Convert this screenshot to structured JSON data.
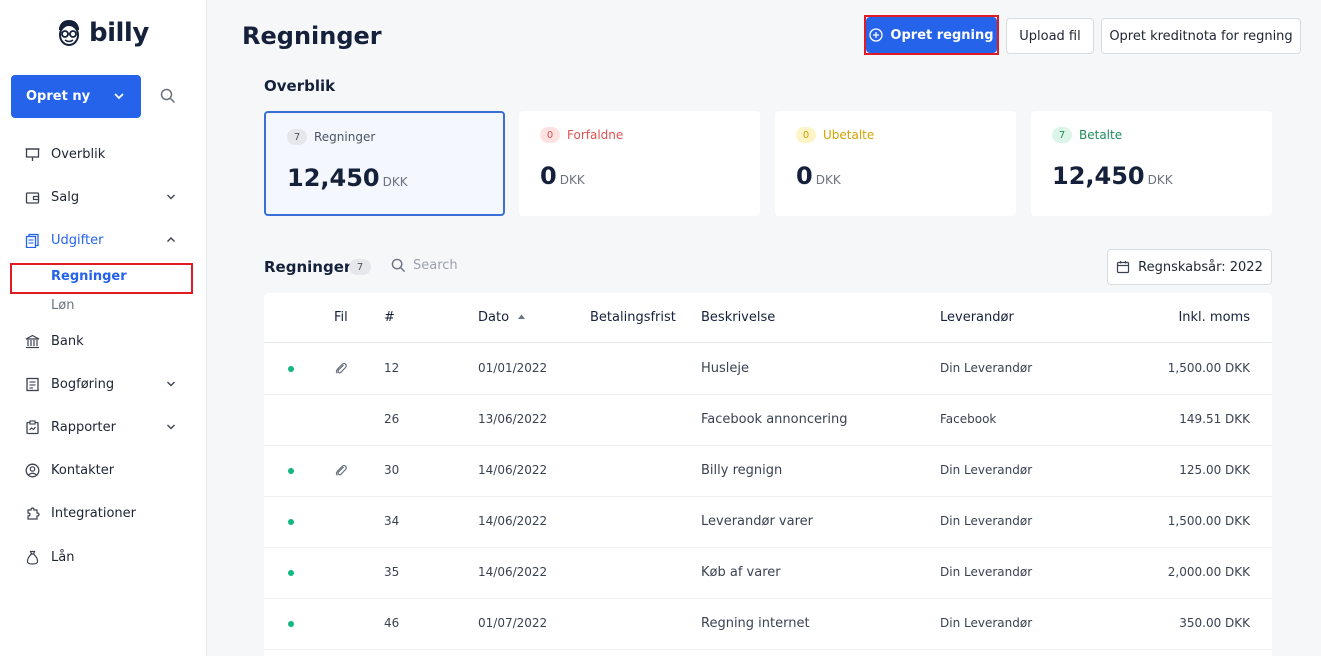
{
  "sidebar": {
    "logo_text": "billy",
    "create_label": "Opret ny",
    "items": [
      {
        "label": "Overblik",
        "icon": "presentation-icon"
      },
      {
        "label": "Salg",
        "icon": "wallet-icon"
      },
      {
        "label": "Udgifter",
        "icon": "receipt-icon"
      },
      {
        "label": "Bank",
        "icon": "bank-icon"
      },
      {
        "label": "Bogføring",
        "icon": "ledger-icon"
      },
      {
        "label": "Rapporter",
        "icon": "report-icon"
      },
      {
        "label": "Kontakter",
        "icon": "user-circle-icon"
      },
      {
        "label": "Integrationer",
        "icon": "puzzle-icon"
      },
      {
        "label": "Lån",
        "icon": "money-bag-icon"
      }
    ],
    "sub_items": [
      "Regninger",
      "Løn"
    ]
  },
  "header": {
    "title": "Regninger",
    "create_bill_label": "Opret regning",
    "upload_label": "Upload fil",
    "credit_note_label": "Opret kreditnota for regning"
  },
  "overview": {
    "title": "Overblik",
    "cards": [
      {
        "count": "7",
        "label": "Regninger",
        "value": "12,450",
        "currency": "DKK"
      },
      {
        "count": "0",
        "label": "Forfaldne",
        "value": "0",
        "currency": "DKK"
      },
      {
        "count": "0",
        "label": "Ubetalte",
        "value": "0",
        "currency": "DKK"
      },
      {
        "count": "7",
        "label": "Betalte",
        "value": "12,450",
        "currency": "DKK"
      }
    ]
  },
  "bills": {
    "title": "Regninger",
    "count": "7",
    "search_placeholder": "Search",
    "fiscal_year_label": "Regnskabsår: 2022",
    "columns": [
      "Fil",
      "#",
      "Dato",
      "Betalingsfrist",
      "Beskrivelse",
      "Leverandør",
      "Inkl. moms"
    ],
    "rows": [
      {
        "number": "12",
        "date": "01/01/2022",
        "description": "Husleje",
        "supplier": "Din Leverandør",
        "amount": "1,500.00 DKK",
        "has_file": true
      },
      {
        "number": "26",
        "date": "13/06/2022",
        "description": "Facebook annoncering",
        "supplier": "Facebook",
        "amount": "149.51 DKK",
        "has_file": false
      },
      {
        "number": "30",
        "date": "14/06/2022",
        "description": "Billy regnign",
        "supplier": "Din Leverandør",
        "amount": "125.00 DKK",
        "has_file": true
      },
      {
        "number": "34",
        "date": "14/06/2022",
        "description": "Leverandør varer",
        "supplier": "Din Leverandør",
        "amount": "1,500.00 DKK",
        "has_file": false
      },
      {
        "number": "35",
        "date": "14/06/2022",
        "description": "Køb af varer",
        "supplier": "Din Leverandør",
        "amount": "2,000.00 DKK",
        "has_file": false
      },
      {
        "number": "46",
        "date": "01/07/2022",
        "description": "Regning internet",
        "supplier": "Din Leverandør",
        "amount": "350.00 DKK",
        "has_file": false
      }
    ]
  },
  "colors": {
    "accent": "#2563eb",
    "highlight": "#e01b24",
    "paid_dot": "#10b981"
  }
}
